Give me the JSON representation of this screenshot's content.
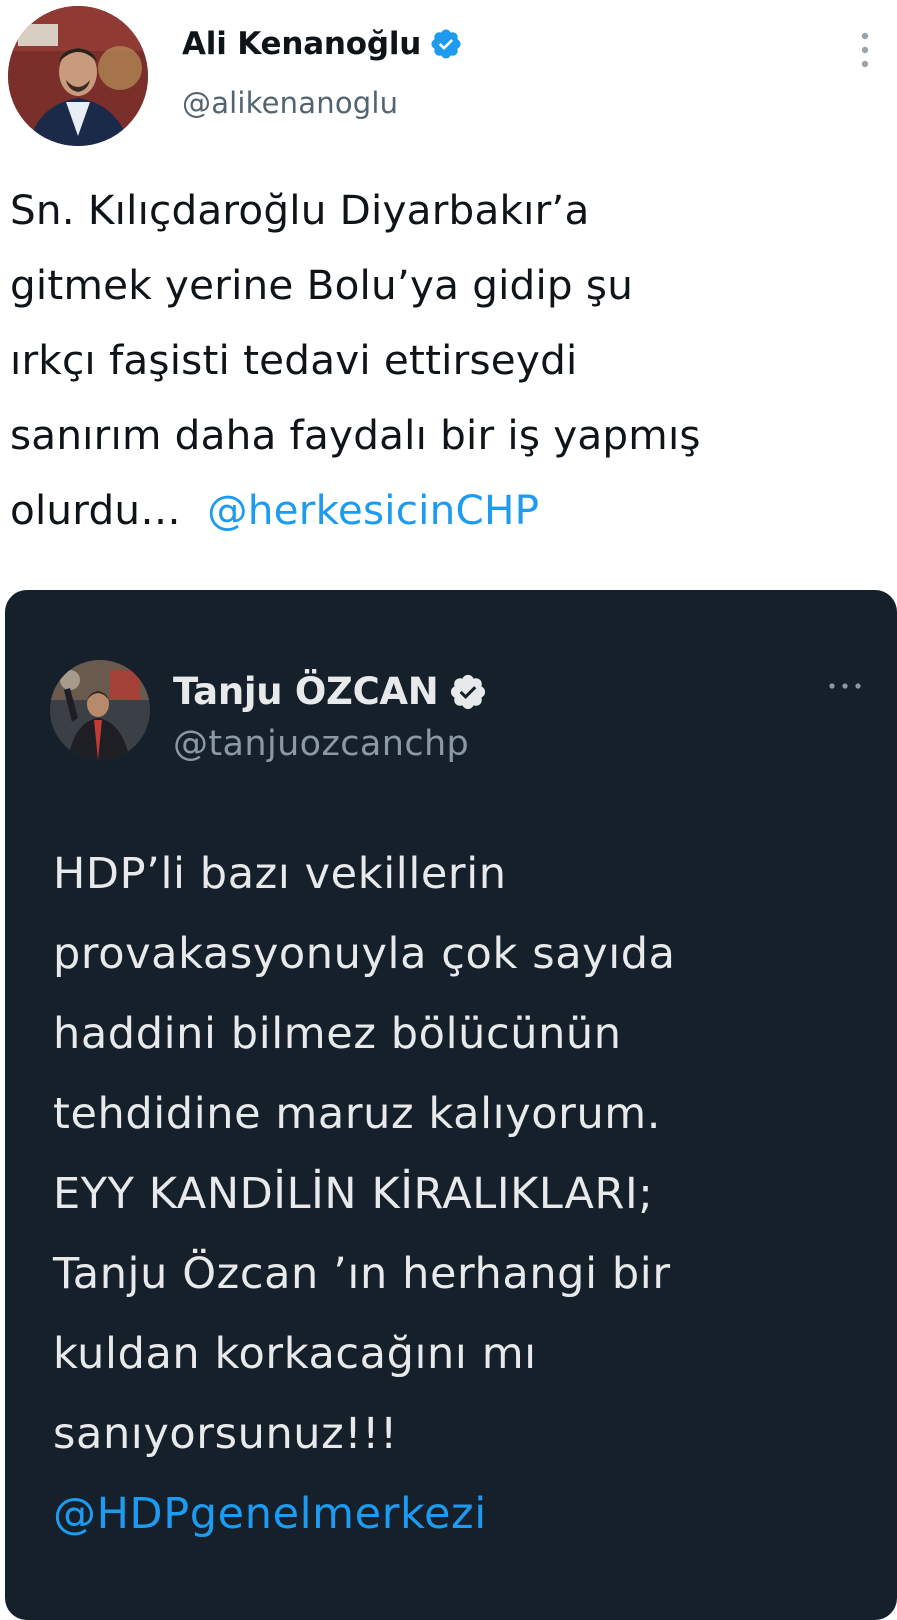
{
  "tweet": {
    "author": {
      "display_name": "Ali Kenanoğlu",
      "handle": "@alikenanoglu",
      "verified": true,
      "avatar_icon": "profile-photo"
    },
    "more_icon": "more-vertical-icon",
    "text_lines": [
      "Sn. Kılıçdaroğlu Diyarbakır’a",
      "gitmek yerine Bolu’ya gidip şu",
      "ırkçı faşisti tedavi ettirseydi",
      "sanırım daha faydalı bir iş yapmış"
    ],
    "last_line_text": "olurdu…",
    "mention": "@herkesicinCHP"
  },
  "quote": {
    "author": {
      "display_name": "Tanju ÖZCAN",
      "handle": "@tanjuozcanchp",
      "verified": true,
      "avatar_icon": "profile-photo"
    },
    "more_icon": "more-horizontal-icon",
    "text_lines": [
      "HDP’li bazı vekillerin",
      "provakasyonuyla çok sayıda",
      "haddini bilmez bölücünün",
      "tehdidine maruz kalıyorum.",
      "EYY KANDİLİN KİRALIKLARI;",
      "Tanju Özcan ’ın herhangi bir",
      "kuldan korkacağını mı",
      "sanıyorsunuz!!!"
    ],
    "mention": "@HDPgenelmerkezi"
  },
  "colors": {
    "accent": "#1d9bf0",
    "quote_background": "#15202b",
    "text_primary": "#0f1419",
    "text_secondary": "#536471"
  }
}
